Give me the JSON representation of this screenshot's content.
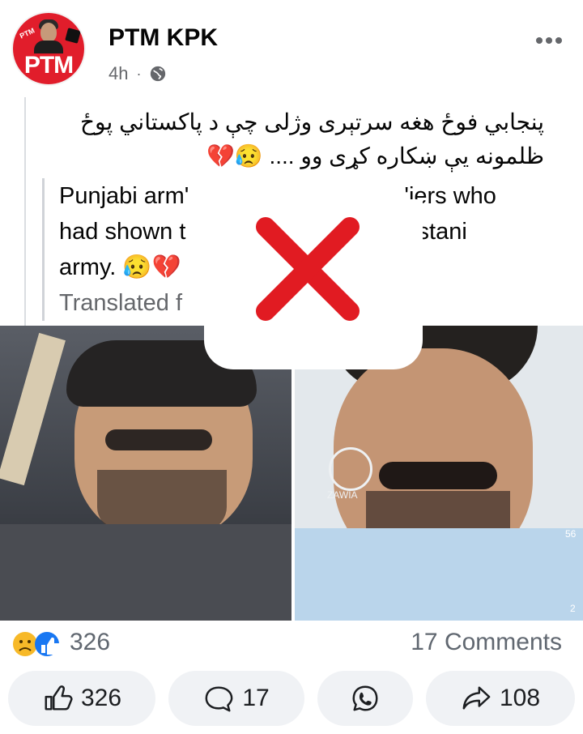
{
  "post": {
    "page_name": "PTM KPK",
    "time": "4h",
    "separator": "·",
    "avatar_text": "PTM",
    "avatar_small_text": "PTM",
    "urdu_line1": "پنجابي فوځ هغه سرتېرى وژلى چې د پاكستاني پوځ",
    "urdu_line2": "ظلمونه يې ښكاره كړى وو .... 😥💔",
    "translated_line1_left": "Punjabi arm'",
    "translated_line1_right": "'iers who",
    "translated_line2_left": "had shown t",
    "translated_line2_right": "stani",
    "translated_line3": "army. 😥💔",
    "translated_label": "Translated f"
  },
  "stats": {
    "reaction_count": "326",
    "comments": "17 Comments"
  },
  "actions": {
    "like": "326",
    "comment": "17",
    "share": "108"
  },
  "overlays": {
    "watermark": "ZAWIA",
    "like_side_count": "56",
    "comment_side_count": "2"
  },
  "icons": {
    "globe": "globe-icon",
    "more": "more-icon",
    "like": "like-icon",
    "comment": "comment-icon",
    "whatsapp": "whatsapp-icon",
    "share": "share-icon",
    "x": "red-x-icon"
  },
  "colors": {
    "brand": "#e11d2b",
    "muted": "#65676b",
    "button_bg": "#f0f2f5",
    "x_red": "#e11b22"
  }
}
